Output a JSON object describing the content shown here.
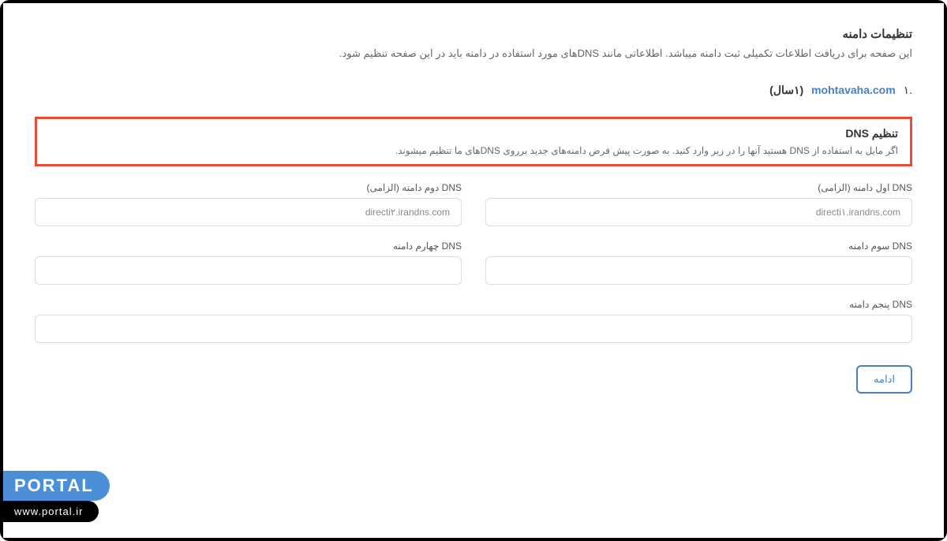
{
  "page": {
    "title": "تنظیمات دامنه",
    "description": "این صفحه برای دریافت اطلاعات تکمیلی ثبت دامنه میباشد. اطلاعاتی مانند DNSهای مورد استفاده در دامنه باید در این صفحه تنظیم شود."
  },
  "domain": {
    "number": ".۱",
    "name": "mohtavaha.com",
    "year": "(۱سال)"
  },
  "dns": {
    "title": "تنظیم DNS",
    "description": "اگر مایل به استفاده از DNS هستید آنها را در زیر وارد کنید. به صورت پیش فرض دامنه‌های جدید برروی DNSهای ما تنظیم میشوند."
  },
  "fields": {
    "dns1_label": "DNS اول دامنه (الزامی)",
    "dns1_value": "directi۱.irandns.com",
    "dns2_label": "DNS دوم دامنه (الزامی)",
    "dns2_value": "directi۲.irandns.com",
    "dns3_label": "DNS سوم دامنه",
    "dns3_value": "",
    "dns4_label": "DNS چهارم دامنه",
    "dns4_value": "",
    "dns5_label": "DNS پنجم دامنه",
    "dns5_value": ""
  },
  "button": {
    "continue_label": "ادامه"
  },
  "watermark": {
    "portal": "PORTAL",
    "url": "www.portal.ir"
  }
}
